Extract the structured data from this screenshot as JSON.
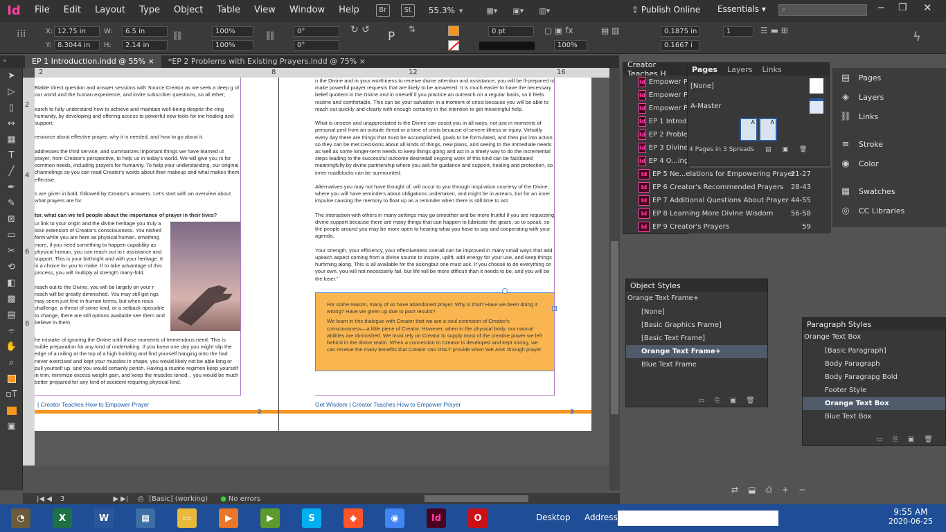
{
  "app": {
    "logo": "Id"
  },
  "menu": [
    "File",
    "Edit",
    "Layout",
    "Type",
    "Object",
    "Table",
    "View",
    "Window",
    "Help"
  ],
  "topbar": {
    "br": "Br",
    "st": "St",
    "zoom": "55.3%",
    "publish": "Publish Online",
    "workspace": "Essentials"
  },
  "controls": {
    "x": "12.75 in",
    "y": "8.3044 in",
    "w": "6.5 in",
    "h": "2.14 in",
    "scale_x": "100%",
    "scale_y": "100%",
    "rotate": "0°",
    "shear": "0°",
    "stroke": "0 pt",
    "opacity": "100%",
    "inset1": "0.1875 in",
    "inset2": "0.1667 i",
    "cols": "1",
    "label_x": "X:",
    "label_y": "Y:",
    "label_w": "W:",
    "label_h": "H:"
  },
  "tabs": [
    {
      "label": "EP 1 Introduction.indd @ 55%",
      "close": "×"
    },
    {
      "label": "*EP 2 Problems with Existing Prayers.indd @ 75%",
      "close": "×"
    }
  ],
  "ruler": {
    "h": [
      "2",
      "8",
      "12",
      "16"
    ],
    "v": [
      "2",
      "4",
      "6",
      "8"
    ]
  },
  "page_left": {
    "p1": "Blable direct question and answer sessions with Source Creator as we seek a deep g of our world and the human experience, and invite subscriber questions, so all ether;",
    "p2": "earch to fully understand how to achieve and maintain well-being despite the cing humanity, by developing and offering access to powerful new tools for ine healing and support;",
    "p3": "resource about effective prayer, why it is needed, and how to go about it.",
    "p4": "addresses the third service, and summarizes important things we have learned ut prayer, from Creator's perspective, to help us in today's world. We will give you rs for common needs, including prayers for humanity. To help your understanding, our original channelings so you can read Creator's words about their makeup and what makes them effective.",
    "p5": "s are given in bold, followed by Creator's answers. Let's start with an overview about what prayers are for.",
    "p6": "tor, what can we tell people about the importance of prayer in their lives?",
    "p7": "ur link to your origin and the divine heritage you truly a soul extension of Creator's consciousness. You nished form while you are here as physical human. omething more, if you need something to happen capability as physical human, you can reach out to r assistance and support. This is your birthright and with your heritage. It is a choice for you to make. If to take advantage of this process, you will multiply al strength many-fold.",
    "p8": "reach out to the Divine, you will be largely on your r reach will be greatly diminished. You may still get ngs may seem just fine in human terms, but when rious challenge, a threat of some kind, or a setback npossible to change, there are still options available see them and believe in them.",
    "p9": "he mistake of ignoring the Divine until those moments of tremendous need. This is ssible preparation for any kind of undertaking. If you knew one day you might slip the edge of a railing at the top of a high building and find yourself hanging onto the had never exercised and kept your muscles in shape, you would likely not be able long or pull yourself up, and you would certainly perish. Having a routine regimen keep yourself in trim, minimize excess weight gain, and keep the muscles toned, , you would be much better prepared for any kind of accident requiring physical kind.",
    "footer": "| Creator Teaches How to Empower Prayer",
    "page_num": "2"
  },
  "page_right": {
    "p1": "n the Divine and in your worthiness to receive divine attention and assistance, you will be ll-prepared to make powerful prayer requests that are likely to be answered. It is much easier to have the necessary belief quotient in the Divine and in oneself if you practice an outreach on a regular basis, so it feels routine and comfortable. This can be your salvation in a moment of crisis because you will be able to reach out quickly and clearly with enough certainty in the intention to get meaningful help.",
    "p2": "What is unseen and unappreciated is the Divine can assist you in all ways, not just in moments of personal peril from an outside threat or a time of crisis because of severe illness or injury. Virtually every day there are things that must be accomplished, goals to be formulated, and then put into action so they can be met.Decisions about all kinds of things, new plans, and seeing to the immediate needs as well as some longer-term needs to keep things going and act in a timely way to do the incremental steps leading to the successful outcome desiredall ongoing work of this kind can be facilitated meaningfully by divine partnership where you ask for guidance and support, healing and protection, so inner roadblocks can be surmounted.",
    "p3": "Alternatives you may not have thought of, will occur to you through inspiration courtesy of the Divine, where you will have reminders about obligations undertaken, and might be in arrears, but for an inner impulse causing the memory to float up as a reminder when there is still time to act.",
    "p4": "The interaction with others in many settings may go smoother and be more fruitful if you are requesting divine support because there are many things that can happen to lubricate the gears, so to speak, so the people around you may be more open to hearing what you have to say and cooperating with your agenda.",
    "p5": "Your strength, your efficiency, your effectiveness overall can be improved in many small ways that add upeach aspect coming from a divine source to inspire, uplift, add energy for your use, and keep things humming along. This is all available for the askingbut one must ask. If you choose to do everything on your own, you will not necessarily fail, but life will be more difficult than it needs to be, and you will be the loser.\"",
    "box1": "For some reason, many of us have abandoned prayer. Why is that? Have we been doing it wrong? Have we given up due to poor results?",
    "box2": "We learn in this dialogue with Creator that we are a soul extension of Creator's consciousness—a little piece of Creator. However, when in the physical body, our natural abilities are diminished. We must rely on Creator to supply most of the creative power we left behind in the divine realm. When a connection to Creator is developed and kept strong, we can receive the many benefits that Creator can ONLY provide when WE ASK through prayer.",
    "footer": "Get Wisdom | Creator Teaches How to Empower Prayer",
    "page_num": "3"
  },
  "status": {
    "page": "3",
    "style": "[Basic] (working)",
    "preflight": "No errors"
  },
  "book_panel": {
    "title": "Creator Teaches H",
    "items": [
      {
        "name": "Empower Pra",
        "pages": ""
      },
      {
        "name": "Empower Pra",
        "pages": ""
      },
      {
        "name": "Empower Pra",
        "pages": ""
      },
      {
        "name": "EP 1 Introdu",
        "pages": ""
      },
      {
        "name": "EP 2 Problen",
        "pages": ""
      },
      {
        "name": "EP 3 Divine I",
        "pages": ""
      },
      {
        "name": "EP 4  O...ing",
        "pages": ""
      },
      {
        "name": "EP 5 Ne...elations for Empowering Prayer",
        "pages": "21-27"
      },
      {
        "name": "EP 6 Creator's Recommended Prayers",
        "pages": "28-43"
      },
      {
        "name": "EP 7 Additional Questions About Prayer",
        "pages": "44-55"
      },
      {
        "name": "EP 8 Learning More Divine Wisdom",
        "pages": "56-58"
      },
      {
        "name": "EP 9 Creator's Prayers",
        "pages": "59"
      }
    ]
  },
  "pages_panel": {
    "tabs": [
      "Pages",
      "Layers",
      "Links"
    ],
    "none": "[None]",
    "master": "A-Master",
    "summary": "4 Pages in 3 Spreads",
    "thumb_label": "A"
  },
  "object_styles": {
    "title": "Object Styles",
    "current": "Orange Text Frame+",
    "items": [
      "[None]",
      "[Basic Graphics Frame]",
      "[Basic Text Frame]",
      "Orange Text Frame+",
      "Blue Text Frame"
    ],
    "selected": 3
  },
  "paragraph_styles": {
    "title": "Paragraph Styles",
    "current": "Orange Text Box",
    "items": [
      "[Basic Paragraph]",
      "Body Paragraph",
      "Body Paragrapg Bold",
      "Footer Style",
      "Orange Text Box",
      "Blue Text Box"
    ],
    "selected": 4
  },
  "dock": {
    "items": [
      {
        "label": "Pages",
        "icon": "pages-icon"
      },
      {
        "label": "Layers",
        "icon": "layers-icon"
      },
      {
        "label": "Links",
        "icon": "links-icon"
      },
      {
        "label": "Stroke",
        "icon": "stroke-icon"
      },
      {
        "label": "Color",
        "icon": "color-icon"
      },
      {
        "label": "Swatches",
        "icon": "swatches-icon"
      },
      {
        "label": "CC Libraries",
        "icon": "cc-libraries-icon"
      }
    ]
  },
  "taskbar": {
    "desktop": "Desktop",
    "address": "Address",
    "time": "9:55 AM",
    "date": "2020-06-25",
    "apps": [
      "gimp",
      "excel",
      "word",
      "control-panel",
      "file-explorer",
      "media-player",
      "play",
      "skype",
      "brave",
      "chrome",
      "indesign",
      "opera"
    ]
  },
  "colors": {
    "orange_box": "#f8b550",
    "accent_orange": "#f7941d",
    "indesign_pink": "#ff3ea5",
    "selection": "#4f5a6a"
  }
}
